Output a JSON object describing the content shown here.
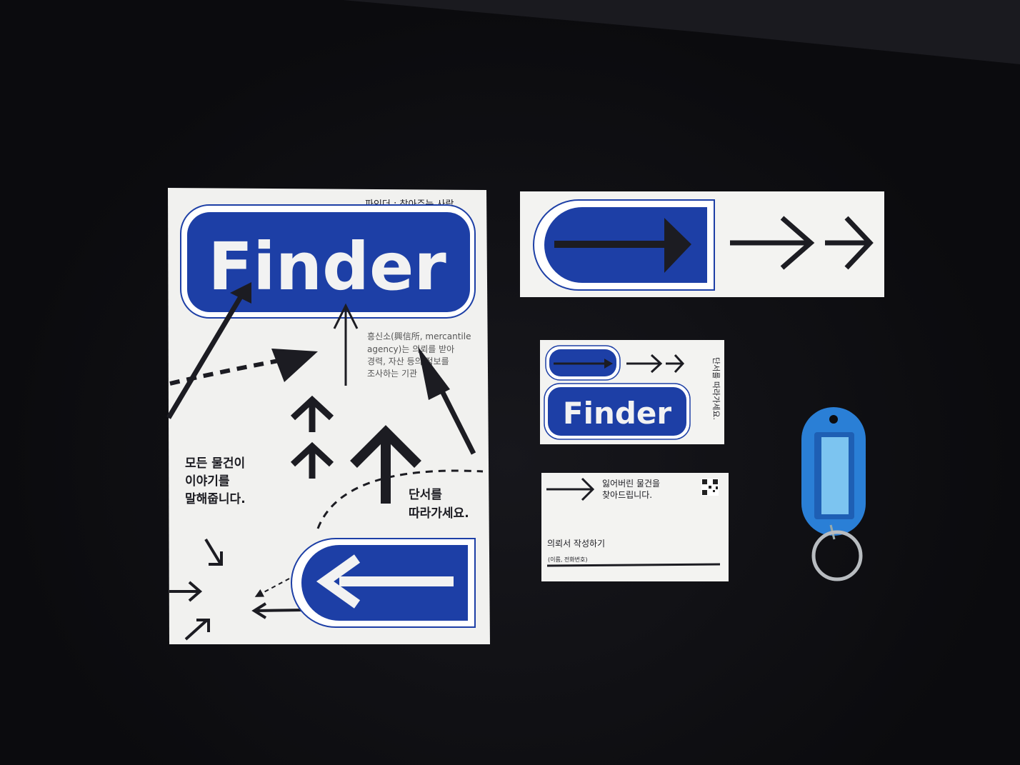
{
  "colors": {
    "background": "#0c0c0f",
    "brand_blue": "#1d3fa6",
    "paper": "#f2f2f0",
    "ink": "#1c1c22",
    "keytag": "#2a7fd6"
  },
  "poster": {
    "header": "파인더 : 찾아주는 사람",
    "logo": "Finder",
    "description": [
      "흥신소(興信所, mercantile",
      "agency)는 의뢰를 받아",
      "경력, 자산 등의 정보를",
      "조사하는 기관"
    ],
    "slogan": [
      "모든 물건이",
      "이야기를",
      "말해줍니다."
    ],
    "follow": [
      "단서를",
      "따라가세요."
    ]
  },
  "small_card": {
    "logo": "Finder",
    "vertical_text": "단서를 따라가세요."
  },
  "business_card": {
    "headline": [
      "잃어버린 물건을",
      "찾아드립니다."
    ],
    "form_title": "의뢰서 작성하기",
    "form_hint": "(이름, 전화번호)"
  },
  "objects": [
    "arrow-sticker",
    "keytag-icon"
  ]
}
